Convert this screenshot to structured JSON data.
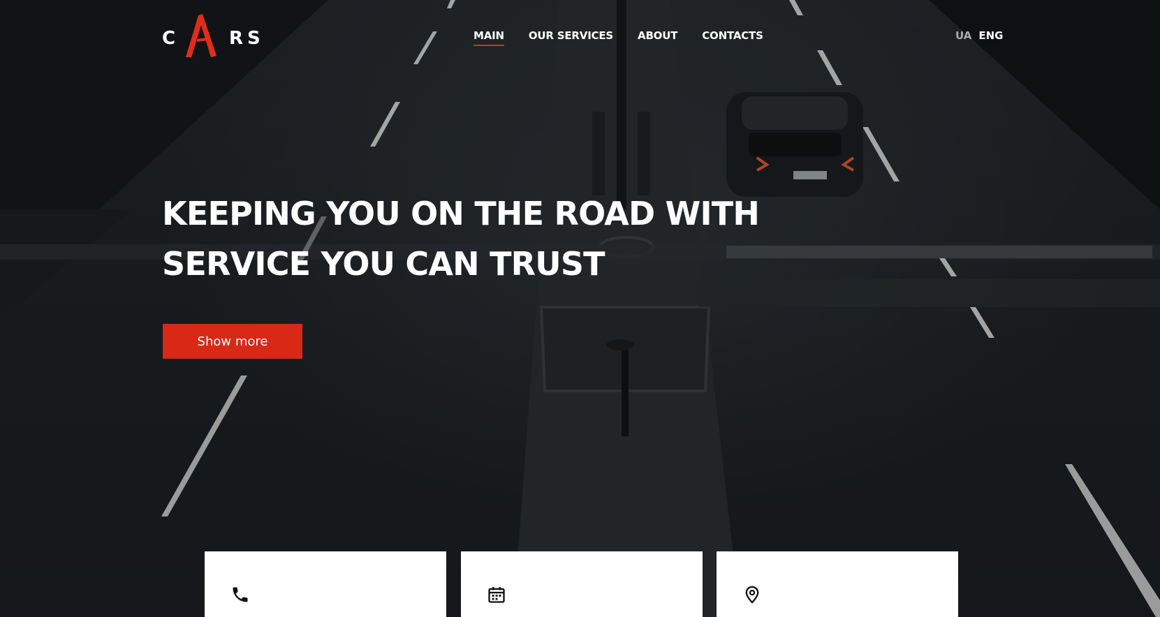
{
  "brand": {
    "letters": [
      "C",
      "R",
      "S"
    ],
    "accent_color": "#e32b1a"
  },
  "nav": {
    "items": [
      {
        "label": "MAIN",
        "active": true
      },
      {
        "label": "OUR SERVICES",
        "active": false
      },
      {
        "label": "ABOUT",
        "active": false
      },
      {
        "label": "CONTACTS",
        "active": false
      }
    ]
  },
  "language": {
    "options": [
      "UA",
      "ENG"
    ],
    "selected": "ENG"
  },
  "hero": {
    "headline_line1": "KEEPING YOU ON THE ROAD WITH",
    "headline_line2": "SERVICE YOU CAN TRUST",
    "button_label": "Show more",
    "button_color": "#d92816"
  },
  "cards": [
    {
      "icon": "phone-icon"
    },
    {
      "icon": "calendar-icon"
    },
    {
      "icon": "location-pin-icon"
    }
  ]
}
